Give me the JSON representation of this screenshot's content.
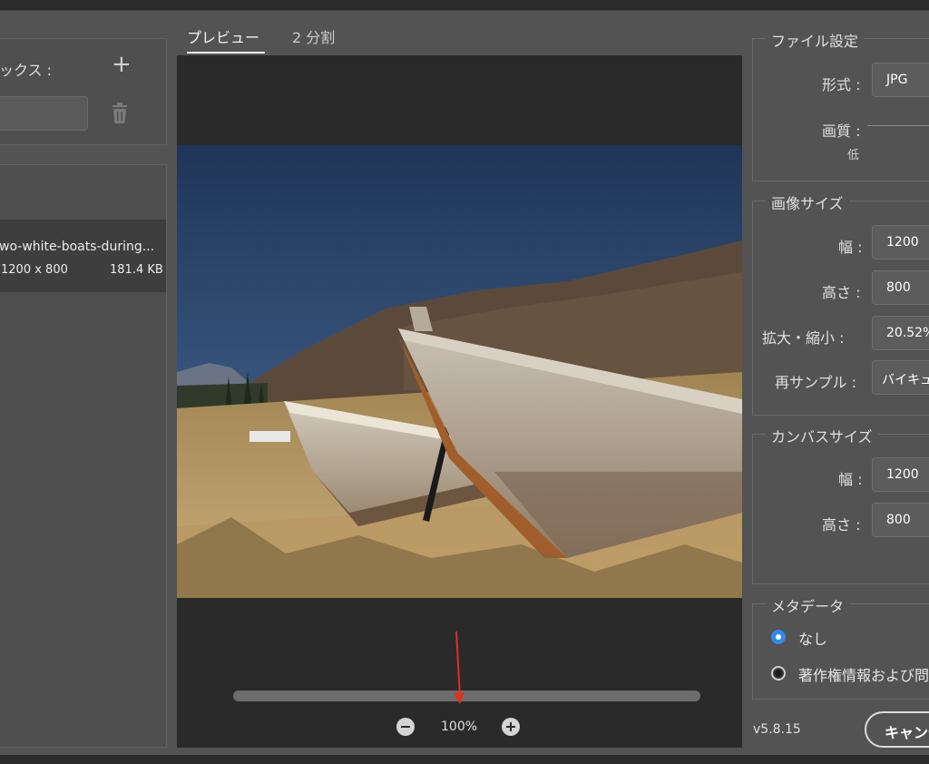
{
  "left_panel": {
    "preset_label": "ックス :",
    "asset": {
      "name": "wo-white-boats-during...",
      "dimensions": "1200 x 800",
      "file_size": "181.4 KB"
    }
  },
  "tabs": {
    "preview": "プレビュー",
    "split": "2 分割"
  },
  "zoom": {
    "level": "100%"
  },
  "file_settings": {
    "legend": "ファイル設定",
    "format_label": "形式 :",
    "format_value": "JPG",
    "quality_label": "画質 :",
    "quality_low": "低"
  },
  "image_size": {
    "legend": "画像サイズ",
    "width_label": "幅 :",
    "width_value": "1200",
    "height_label": "高さ :",
    "height_value": "800",
    "scale_label": "拡大・縮小 :",
    "scale_value": "20.52%",
    "resample_label": "再サンプル :",
    "resample_value": "バイキュー"
  },
  "canvas_size": {
    "legend": "カンバスサイズ",
    "width_label": "幅 :",
    "width_value": "1200",
    "height_label": "高さ :",
    "height_value": "800"
  },
  "metadata": {
    "legend": "メタデータ",
    "option_none": "なし",
    "option_copyright": "著作権情報および問"
  },
  "footer": {
    "version": "v5.8.15",
    "cancel": "キャンセル"
  },
  "colors": {
    "background": "#535353",
    "preview_bg": "#2a2a2a",
    "accent": "#2f8ae8",
    "annotation_arrow": "#e0301e"
  }
}
